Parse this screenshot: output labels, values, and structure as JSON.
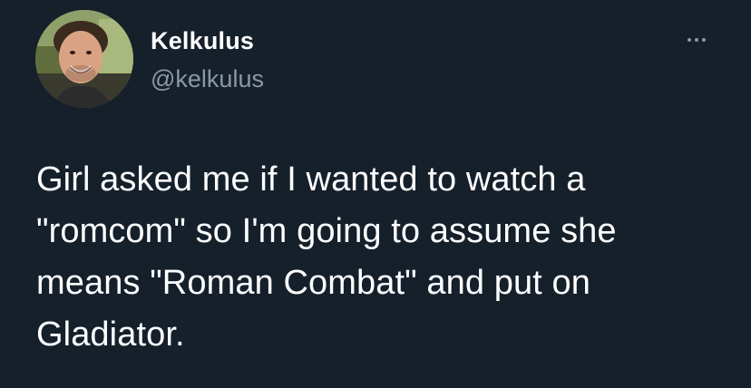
{
  "tweet": {
    "author": {
      "display_name": "Kelkulus",
      "handle": "@kelkulus",
      "avatar_icon": "profile-photo"
    },
    "more_icon": "more-horizontal-icon",
    "text": "Girl asked me if I wanted to watch a\n\"romcom\" so I'm going to assume she\nmeans \"Roman Combat\" and put on\nGladiator."
  },
  "colors": {
    "background": "#15202b",
    "primary_text": "#ffffff",
    "secondary_text": "#8b98a5"
  }
}
